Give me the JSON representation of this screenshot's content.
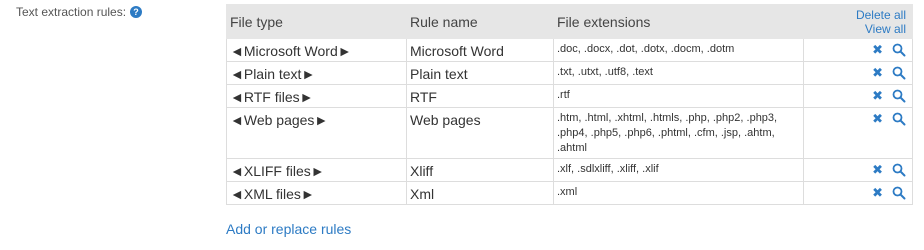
{
  "label": {
    "text": "Text extraction rules:",
    "help_icon": "question-circle-icon"
  },
  "table": {
    "headers": {
      "file_type": "File type",
      "rule_name": "Rule name",
      "extensions": "File extensions"
    },
    "actions": {
      "delete_all": "Delete all",
      "view_all": "View all"
    },
    "rows": [
      {
        "file_type": "◄Microsoft Word►",
        "rule_name": "Microsoft Word",
        "extensions": ".doc, .docx, .dot, .dotx, .docm, .dotm"
      },
      {
        "file_type": "◄Plain text►",
        "rule_name": "Plain text",
        "extensions": ".txt, .utxt, .utf8, .text"
      },
      {
        "file_type": "◄RTF files►",
        "rule_name": "RTF",
        "extensions": ".rtf"
      },
      {
        "file_type": "◄Web pages►",
        "rule_name": "Web pages",
        "extensions": ".htm, .html, .xhtml, .htmls, .php, .php2, .php3, .php4, .php5, .php6, .phtml, .cfm, .jsp, .ahtm, .ahtml"
      },
      {
        "file_type": "◄XLIFF files►",
        "rule_name": "Xliff",
        "extensions": ".xlf, .sdlxliff, .xliff, .xlif"
      },
      {
        "file_type": "◄XML files►",
        "rule_name": "Xml",
        "extensions": ".xml"
      }
    ],
    "row_icons": {
      "delete": "close-x-icon",
      "view": "search-icon"
    }
  },
  "footer": {
    "link": "Add or replace rules"
  },
  "colors": {
    "accent": "#2d7bc4",
    "header_bg": "#e6e6e6",
    "border": "#dddddd"
  }
}
